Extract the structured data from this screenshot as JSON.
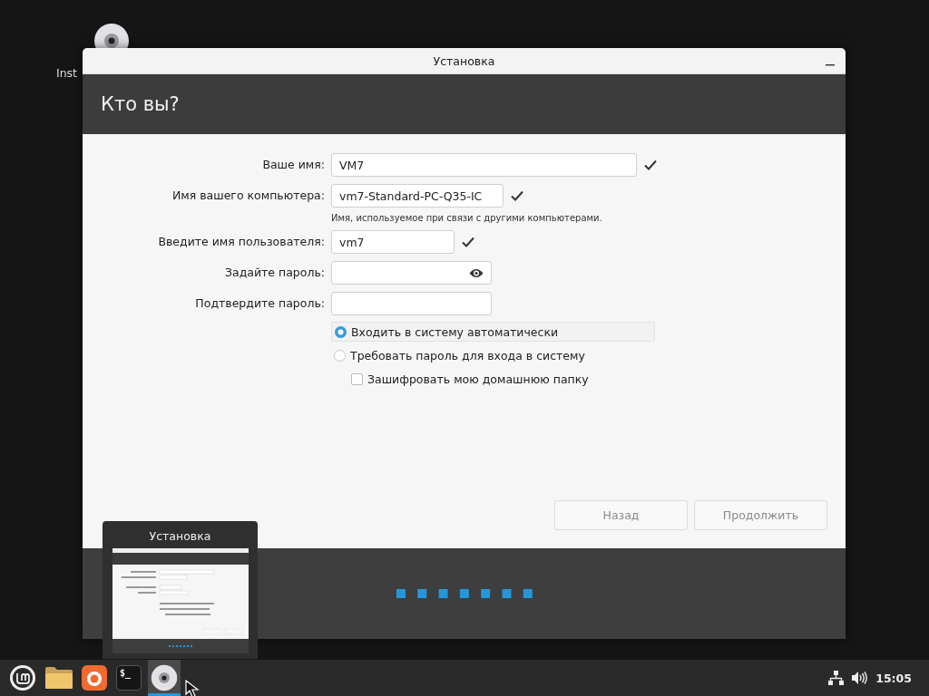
{
  "desktop_icons": [
    {
      "label": "Inst"
    }
  ],
  "window": {
    "title": "Установка",
    "heading": "Кто вы?",
    "fields": [
      {
        "label": "Ваше имя:",
        "value": "VM7",
        "valid": true,
        "reveal_toggle": false
      },
      {
        "label": "Имя вашего компьютера:",
        "value": "vm7-Standard-PC-Q35-IC",
        "valid": true,
        "reveal_toggle": false,
        "hint": "Имя, используемое при связи с другими компьютерами."
      },
      {
        "label": "Введите имя пользователя:",
        "value": "vm7",
        "valid": true,
        "reveal_toggle": false
      },
      {
        "label": "Задайте пароль:",
        "valid": false,
        "reveal_toggle": true
      },
      {
        "label": "Подтвердите пароль:",
        "valid": false,
        "reveal_toggle": false
      }
    ],
    "login_options": [
      {
        "kind": "radio",
        "label": "Входить в систему автоматически",
        "selected": true
      },
      {
        "kind": "radio",
        "label": "Требовать пароль для входа в систему",
        "selected": false
      },
      {
        "kind": "checkbox",
        "label": "Зашифровать мою домашнюю папку",
        "checked": false
      }
    ],
    "buttons": [
      {
        "label": "Назад",
        "disabled": true
      },
      {
        "label": "Продолжить",
        "disabled": true
      }
    ]
  },
  "window_preview": {
    "title": "Установка"
  },
  "taskbar": {
    "apps": [
      {
        "kind": "menu",
        "active": false
      },
      {
        "kind": "folder",
        "active": false
      },
      {
        "kind": "browser",
        "active": false
      },
      {
        "kind": "terminal",
        "glyph": "$_",
        "active": false
      },
      {
        "kind": "disc",
        "active": true
      }
    ],
    "clock": "15:05"
  }
}
